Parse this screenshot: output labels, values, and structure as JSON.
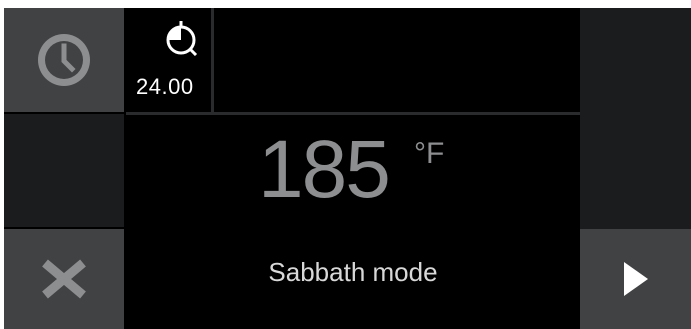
{
  "timer": {
    "icon": "kitchen-timer-icon",
    "value": "24.00"
  },
  "display": {
    "temperature": "185",
    "unit": "°F",
    "mode": "Sabbath mode"
  },
  "buttons": {
    "clock_icon": "clock-icon",
    "cancel_icon": "x-icon",
    "next_icon": "play-triangle-icon"
  },
  "colors": {
    "button_bg": "#414244",
    "panel_dark": "#1b1c1d",
    "temp_text": "#8d8e90"
  }
}
